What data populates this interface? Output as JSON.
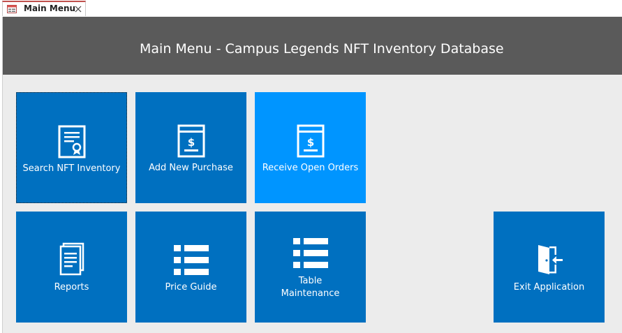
{
  "tab": {
    "label": "Main Menu"
  },
  "header": {
    "title": "Main Menu - Campus Legends NFT Inventory Database"
  },
  "tiles": {
    "search_nft_inventory": "Search NFT Inventory",
    "add_new_purchase": "Add New Purchase",
    "receive_open_orders": "Receive Open Orders",
    "reports": "Reports",
    "price_guide": "Price Guide",
    "table_maintenance_line1": "Table",
    "table_maintenance_line2": "Maintenance",
    "exit_application": "Exit Application"
  },
  "colors": {
    "tile": "#0070c0",
    "tile_highlight": "#0095ff",
    "header": "#5a5a5a",
    "background": "#ececec",
    "tab_accent": "#c0504d"
  },
  "icons": {
    "tab": "form-icon",
    "close": "close-icon",
    "search_nft_inventory": "certificate-icon",
    "add_new_purchase": "invoice-dollar-icon",
    "receive_open_orders": "invoice-dollar-icon",
    "reports": "documents-icon",
    "price_guide": "list-icon",
    "table_maintenance": "list-icon",
    "exit_application": "exit-door-icon"
  }
}
